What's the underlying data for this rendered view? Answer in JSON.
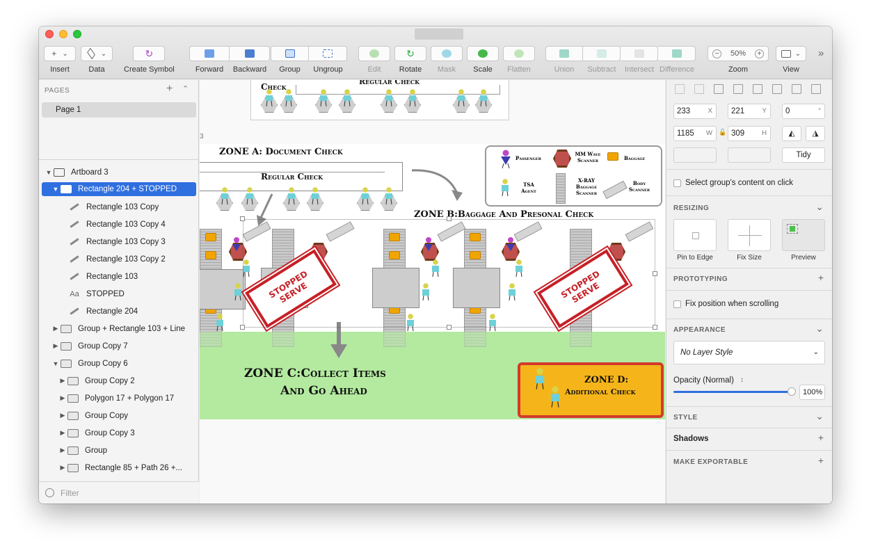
{
  "toolbar": {
    "insert": "Insert",
    "data": "Data",
    "create_symbol": "Create Symbol",
    "forward": "Forward",
    "backward": "Backward",
    "group": "Group",
    "ungroup": "Ungroup",
    "edit": "Edit",
    "rotate": "Rotate",
    "mask": "Mask",
    "scale": "Scale",
    "flatten": "Flatten",
    "union": "Union",
    "subtract": "Subtract",
    "intersect": "Intersect",
    "difference": "Difference",
    "zoom": "Zoom",
    "zoom_value": "50%",
    "view": "View",
    "minus": "−",
    "plus": "+",
    "more": "»",
    "caret": "⌄",
    "insert_plus": "+"
  },
  "sidebar": {
    "pages_header": "PAGES",
    "pages_add": "+",
    "pages_collapse": "⌃",
    "page": "Page 1",
    "filter": "Filter",
    "layers": [
      {
        "label": "Artboard 3",
        "indent": 8,
        "disc": "▼",
        "icon": "artboard",
        "bold": true
      },
      {
        "label": "Rectangle 204 + STOPPED",
        "indent": 18,
        "disc": "▼",
        "icon": "folder",
        "selected": true
      },
      {
        "label": "Rectangle 103 Copy",
        "indent": 30,
        "disc": "",
        "icon": "shape"
      },
      {
        "label": "Rectangle 103 Copy 4",
        "indent": 30,
        "disc": "",
        "icon": "shape"
      },
      {
        "label": "Rectangle 103 Copy 3",
        "indent": 30,
        "disc": "",
        "icon": "shape"
      },
      {
        "label": "Rectangle 103 Copy 2",
        "indent": 30,
        "disc": "",
        "icon": "shape"
      },
      {
        "label": "Rectangle 103",
        "indent": 30,
        "disc": "",
        "icon": "shape"
      },
      {
        "label": "STOPPED",
        "indent": 30,
        "disc": "",
        "icon": "text"
      },
      {
        "label": "Rectangle 204",
        "indent": 30,
        "disc": "",
        "icon": "shape"
      },
      {
        "label": "Group + Rectangle 103 + Line",
        "indent": 18,
        "disc": "▶",
        "icon": "folder"
      },
      {
        "label": "Group Copy 7",
        "indent": 18,
        "disc": "▶",
        "icon": "folder"
      },
      {
        "label": "Group Copy 6",
        "indent": 18,
        "disc": "▼",
        "icon": "folder"
      },
      {
        "label": "Group Copy 2",
        "indent": 28,
        "disc": "▶",
        "icon": "folder"
      },
      {
        "label": "Polygon 17 + Polygon 17",
        "indent": 28,
        "disc": "▶",
        "icon": "folder"
      },
      {
        "label": "Group Copy",
        "indent": 28,
        "disc": "▶",
        "icon": "folder"
      },
      {
        "label": "Group Copy 3",
        "indent": 28,
        "disc": "▶",
        "icon": "folder"
      },
      {
        "label": "Group",
        "indent": 28,
        "disc": "▶",
        "icon": "folder"
      },
      {
        "label": "Rectangle 85 + Path 26 +...",
        "indent": 28,
        "disc": "▶",
        "icon": "folder"
      }
    ]
  },
  "canvas": {
    "top_label": "Check",
    "top_regular": "Regular Check",
    "artboard_label": "3",
    "zone_a": "ZONE A:  Document Check",
    "regular_check": "Regular Check",
    "zone_b": "ZONE B:Baggage And Presonal Check",
    "zone_c_line1": "ZONE C:Collect Items",
    "zone_c_line2": "And Go Ahead",
    "zone_d_line1": "ZONE D:",
    "zone_d_line2": "Additional Check",
    "stamp_line1": "STOPPED",
    "stamp_line2": "SERVE",
    "legend": {
      "passenger": "Passenger",
      "mm_wave": "MM Wave Scanner",
      "baggage": "Baggage",
      "tsa": "TSA Agent",
      "xray": "X-RAY Baggage Scanner",
      "body": "Body Scanner"
    }
  },
  "inspector": {
    "x": "233",
    "x_suf": "X",
    "y": "221",
    "y_suf": "Y",
    "rot": "0",
    "rot_suf": "°",
    "w": "1185",
    "w_suf": "W",
    "h": "309",
    "h_suf": "H",
    "lock": "🔓",
    "flip_h": "◭",
    "flip_v": "◮",
    "tidy": "Tidy",
    "select_group": "Select group's content on click",
    "resizing": "RESIZING",
    "pin": "Pin to Edge",
    "fix": "Fix Size",
    "preview": "Preview",
    "prototyping": "PROTOTYPING",
    "fix_position": "Fix position when scrolling",
    "appearance": "APPEARANCE",
    "layer_style": "No Layer Style",
    "opacity_label": "Opacity (Normal)",
    "opacity_value": "100%",
    "style": "STYLE",
    "shadows": "Shadows",
    "exportable": "MAKE EXPORTABLE",
    "expand": "⌄",
    "add": "+",
    "stepper": "↕"
  },
  "colors": {
    "accent": "#2f6fe0",
    "zone_c_bg": "#b4eaa0",
    "zone_d_bg": "#f5b51a",
    "zone_d_border": "#d33a2c",
    "stamp": "#c62026"
  }
}
